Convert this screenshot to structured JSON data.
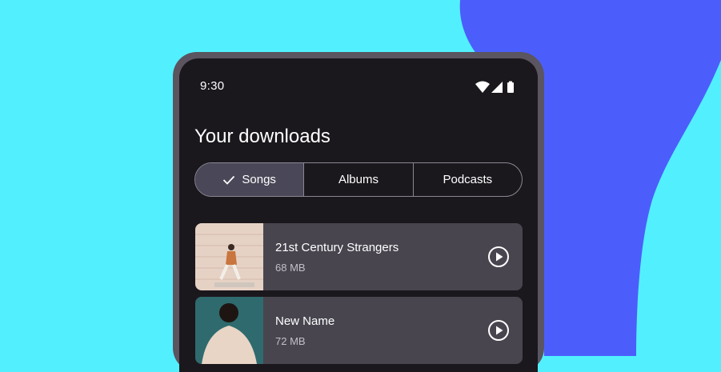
{
  "status": {
    "time": "9:30"
  },
  "page": {
    "title": "Your downloads"
  },
  "tabs": [
    {
      "label": "Songs",
      "selected": true
    },
    {
      "label": "Albums",
      "selected": false
    },
    {
      "label": "Podcasts",
      "selected": false
    }
  ],
  "downloads": [
    {
      "title": "21st Century Strangers",
      "size": "68 MB"
    },
    {
      "title": "New Name",
      "size": "72 MB"
    }
  ],
  "colors": {
    "background": "#52f0ff",
    "blob": "#4b5efb",
    "screen": "#1b181d",
    "card": "#48454f",
    "selected_segment": "#4a4858"
  },
  "icons": [
    "wifi-icon",
    "signal-icon",
    "battery-icon",
    "check-icon",
    "play-icon"
  ]
}
